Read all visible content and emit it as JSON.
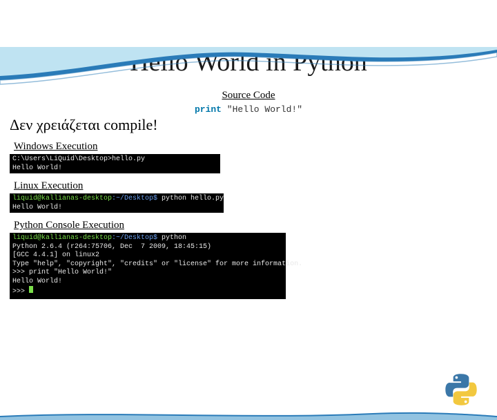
{
  "title": "Hello World in Python",
  "source_label": "Source Code",
  "source_code": {
    "keyword": "print",
    "string": " \"Hello World!\""
  },
  "no_compile": "Δεν χρειάζεται compile!",
  "windows": {
    "label": "Windows Execution",
    "prompt": "C:\\Users\\LiQuid\\Desktop>hello.py",
    "output": "Hello World!"
  },
  "linux": {
    "label": "Linux Execution",
    "user": "liquid@kallianas-desktop",
    "path": ":~/Desktop$ ",
    "cmd": "python hello.py",
    "output": "Hello World!"
  },
  "console": {
    "label": "Python Console Execution",
    "user": "liquid@kallianas-desktop",
    "path": ":~/Desktop$ ",
    "cmd": "python",
    "line1": "Python 2.6.4 (r264:75706, Dec  7 2009, 18:45:15)",
    "line2": "[GCC 4.4.1] on linux2",
    "line3": "Type \"help\", \"copyright\", \"credits\" or \"license\" for more information.",
    "prompt1": ">>> print \"Hello World!\"",
    "output": "Hello World!",
    "prompt2": ">>> "
  }
}
